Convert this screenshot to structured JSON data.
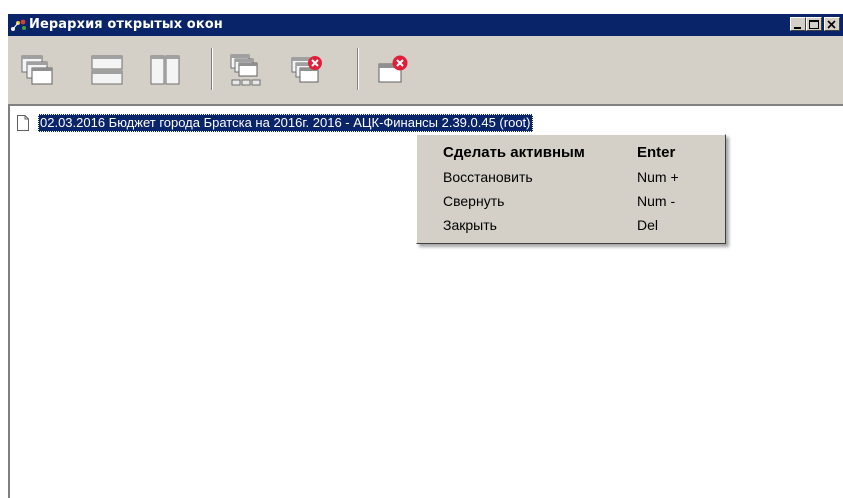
{
  "window": {
    "title": "Иерархия открытых окон",
    "controls": [
      "minimize",
      "maximize",
      "close"
    ]
  },
  "colors": {
    "titlebar": "#0a246a",
    "face": "#d4d0c8",
    "selection": "#0a246a",
    "close_badge": "#e0203a"
  },
  "toolbar": {
    "buttons": [
      {
        "name": "cascade-windows-icon"
      },
      {
        "name": "tile-horizontal-icon"
      },
      {
        "name": "tile-vertical-icon"
      },
      {
        "name": "arrange-icons-icon"
      },
      {
        "name": "close-all-windows-icon"
      },
      {
        "name": "close-window-icon"
      }
    ]
  },
  "tree": {
    "items": [
      {
        "label": "02.03.2016 Бюджет города Братска на 2016г. 2016 - АЦК-Финансы 2.39.0.45 (root)",
        "selected": true
      }
    ]
  },
  "context_menu": {
    "items": [
      {
        "label": "Сделать активным",
        "key": "Enter",
        "default": true
      },
      {
        "label": "Восстановить",
        "key": "Num +"
      },
      {
        "label": "Свернуть",
        "key": "Num -"
      },
      {
        "label": "Закрыть",
        "key": "Del"
      }
    ]
  }
}
